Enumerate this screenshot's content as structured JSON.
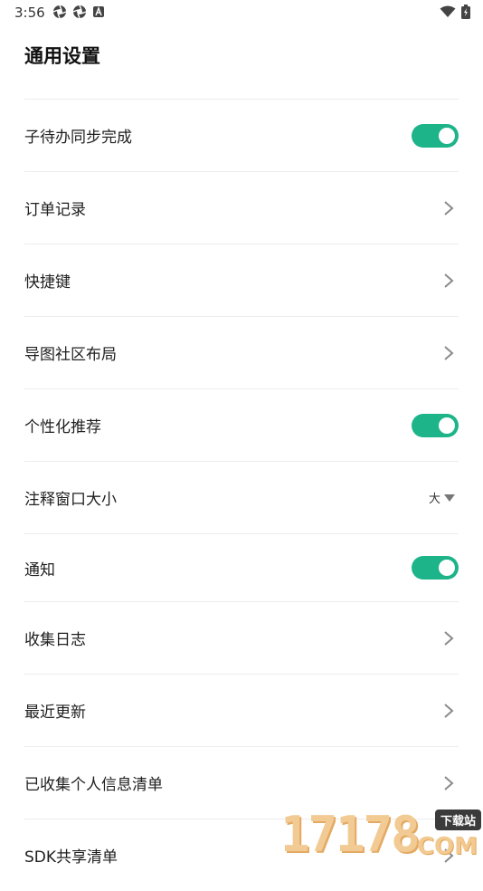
{
  "status_bar": {
    "time": "3:56"
  },
  "page_title": "通用设置",
  "settings": [
    {
      "label": "子待办同步完成",
      "control": "toggle",
      "on": true
    },
    {
      "label": "订单记录",
      "control": "chevron"
    },
    {
      "label": "快捷键",
      "control": "chevron"
    },
    {
      "label": "导图社区布局",
      "control": "chevron"
    },
    {
      "label": "个性化推荐",
      "control": "toggle",
      "on": true
    },
    {
      "label": "注释窗口大小",
      "control": "select",
      "value": "大"
    },
    {
      "label": "通知",
      "control": "toggle",
      "on": true
    },
    {
      "label": "收集日志",
      "control": "chevron"
    },
    {
      "label": "最近更新",
      "control": "chevron"
    },
    {
      "label": "已收集个人信息清单",
      "control": "chevron"
    },
    {
      "label": "SDK共享清单",
      "control": "chevron"
    }
  ],
  "watermark": {
    "digits": "17178",
    "badge": "下载站",
    "suffix": "COM"
  },
  "colors": {
    "toggle_on": "#1db48a",
    "divider": "#ececec",
    "chevron": "#8a8a8a"
  }
}
